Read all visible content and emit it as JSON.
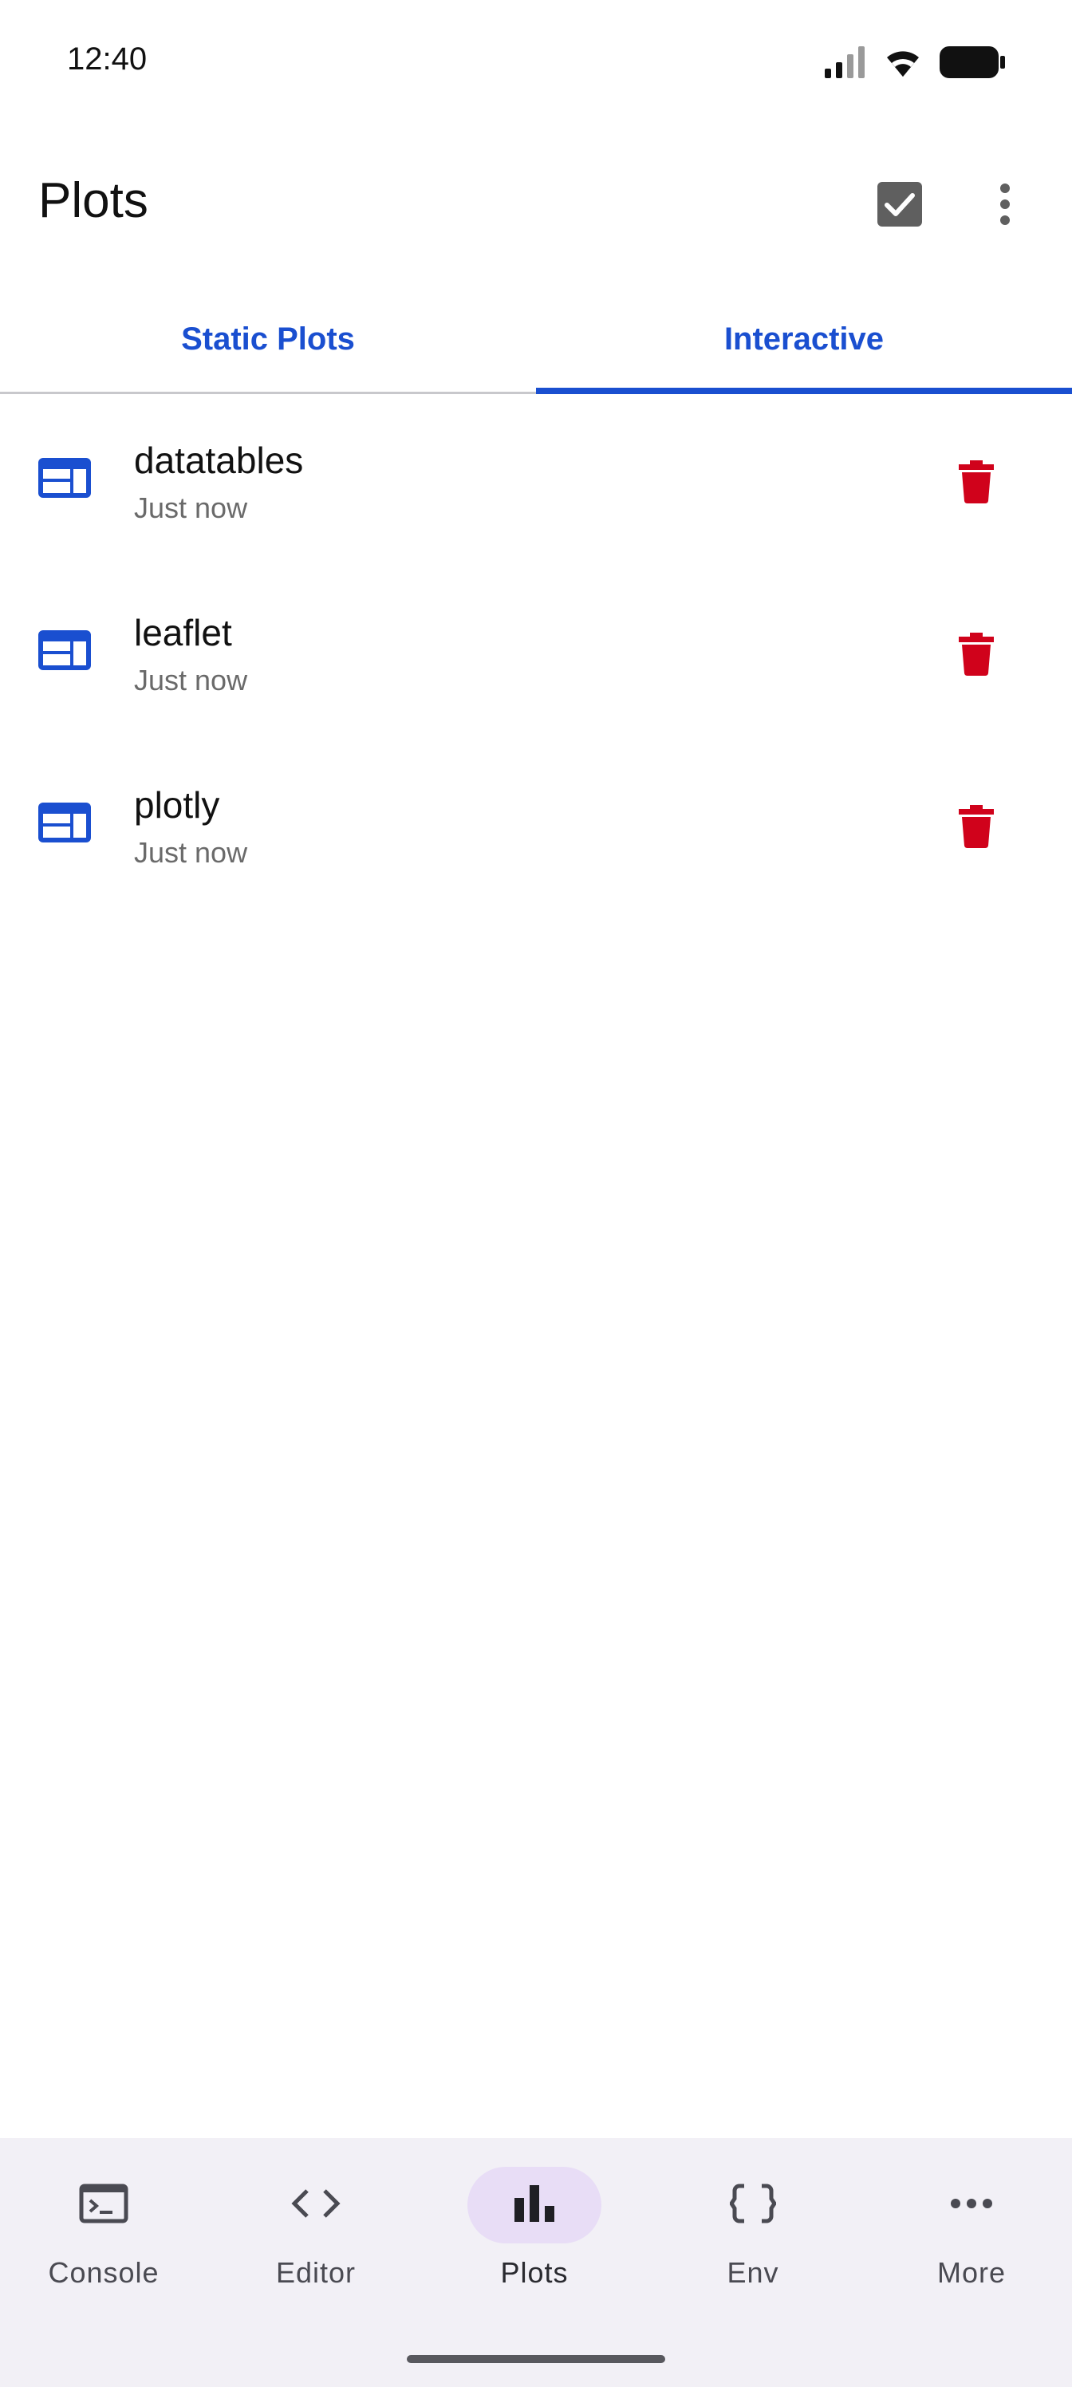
{
  "status_bar": {
    "time": "12:40",
    "icons": [
      "signal-icon",
      "wifi-icon",
      "battery-icon"
    ]
  },
  "app_bar": {
    "title": "Plots",
    "actions": [
      "checkbox-checked-icon",
      "more-vert-icon"
    ]
  },
  "tabs": [
    {
      "label": "Static Plots",
      "selected": false
    },
    {
      "label": "Interactive",
      "selected": true
    }
  ],
  "plots": [
    {
      "name": "datatables",
      "time": "Just now",
      "icon": "web-icon"
    },
    {
      "name": "leaflet",
      "time": "Just now",
      "icon": "web-icon"
    },
    {
      "name": "plotly",
      "time": "Just now",
      "icon": "web-icon"
    }
  ],
  "bottom_nav": {
    "items": [
      {
        "label": "Console",
        "icon": "terminal-icon",
        "active": false
      },
      {
        "label": "Editor",
        "icon": "code-icon",
        "active": false
      },
      {
        "label": "Plots",
        "icon": "bar-chart-icon",
        "active": true
      },
      {
        "label": "Env",
        "icon": "braces-icon",
        "active": false
      },
      {
        "label": "More",
        "icon": "more-horiz-icon",
        "active": false
      }
    ]
  },
  "colors": {
    "accent": "#1a4fd0",
    "delete": "#d0021b",
    "nav_background": "#f2f0f6",
    "nav_active_pill": "#e8ddf6"
  }
}
